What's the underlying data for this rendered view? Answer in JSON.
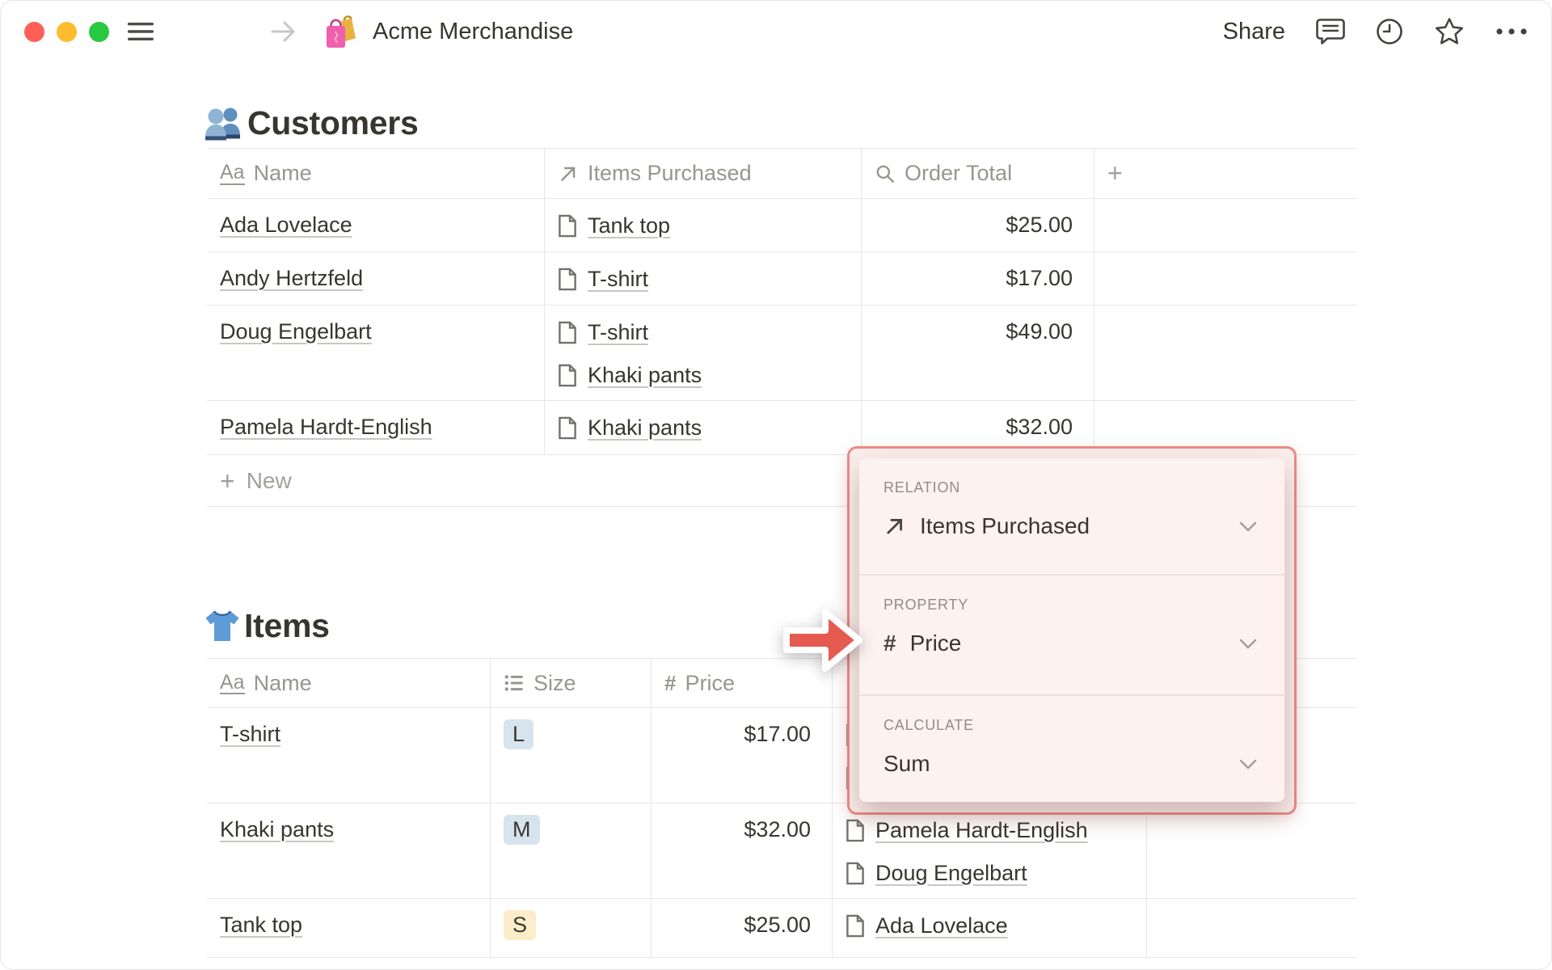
{
  "window": {
    "title": "Acme Merchandise",
    "share_label": "Share"
  },
  "customers_section": {
    "title": "Customers",
    "table": {
      "columns": [
        {
          "label": "Name",
          "type": "title"
        },
        {
          "label": "Items Purchased",
          "type": "relation"
        },
        {
          "label": "Order Total",
          "type": "rollup"
        },
        {
          "label": "+",
          "type": "add-property"
        }
      ],
      "rows": [
        {
          "name": "Ada Lovelace",
          "items": [
            "Tank top"
          ],
          "order_total": "$25.00"
        },
        {
          "name": "Andy Hertzfeld",
          "items": [
            "T-shirt"
          ],
          "order_total": "$17.00"
        },
        {
          "name": "Doug Engelbart",
          "items": [
            "T-shirt",
            "Khaki pants"
          ],
          "order_total": "$49.00"
        },
        {
          "name": "Pamela Hardt-English",
          "items": [
            "Khaki pants"
          ],
          "order_total": "$32.00"
        }
      ],
      "new_row_label": "New"
    }
  },
  "items_section": {
    "title": "Items",
    "table": {
      "columns": [
        {
          "label": "Name",
          "type": "title"
        },
        {
          "label": "Size",
          "type": "select"
        },
        {
          "label": "Price",
          "type": "number"
        },
        {
          "label": "",
          "type": "relation"
        }
      ],
      "rows": [
        {
          "name": "T-shirt",
          "size": "L",
          "size_color": "blue",
          "price": "$17.00",
          "purchased_by": [],
          "hidden_purchaser_icons": 2
        },
        {
          "name": "Khaki pants",
          "size": "M",
          "size_color": "blue",
          "price": "$32.00",
          "purchased_by": [
            "Pamela Hardt-English",
            "Doug Engelbart"
          ]
        },
        {
          "name": "Tank top",
          "size": "S",
          "size_color": "yellow",
          "price": "$25.00",
          "purchased_by": [
            "Ada Lovelace"
          ]
        }
      ]
    }
  },
  "popup": {
    "relation_label": "RELATION",
    "relation_value": "Items Purchased",
    "property_label": "PROPERTY",
    "property_value": "Price",
    "calculate_label": "CALCULATE",
    "calculate_value": "Sum"
  },
  "colors": {
    "annotation_red": "#e65b50",
    "popup_border": "#ec8b85",
    "popup_bg": "#fdf2f0",
    "tag_blue": "#d7e4ee",
    "tag_yellow": "#fbedc9",
    "text": "#37352f",
    "muted_text": "#97958f",
    "table_border": "#e7e6e4",
    "traffic_red": "#ff5f57",
    "traffic_yellow": "#febc2e",
    "traffic_green": "#28c840"
  }
}
